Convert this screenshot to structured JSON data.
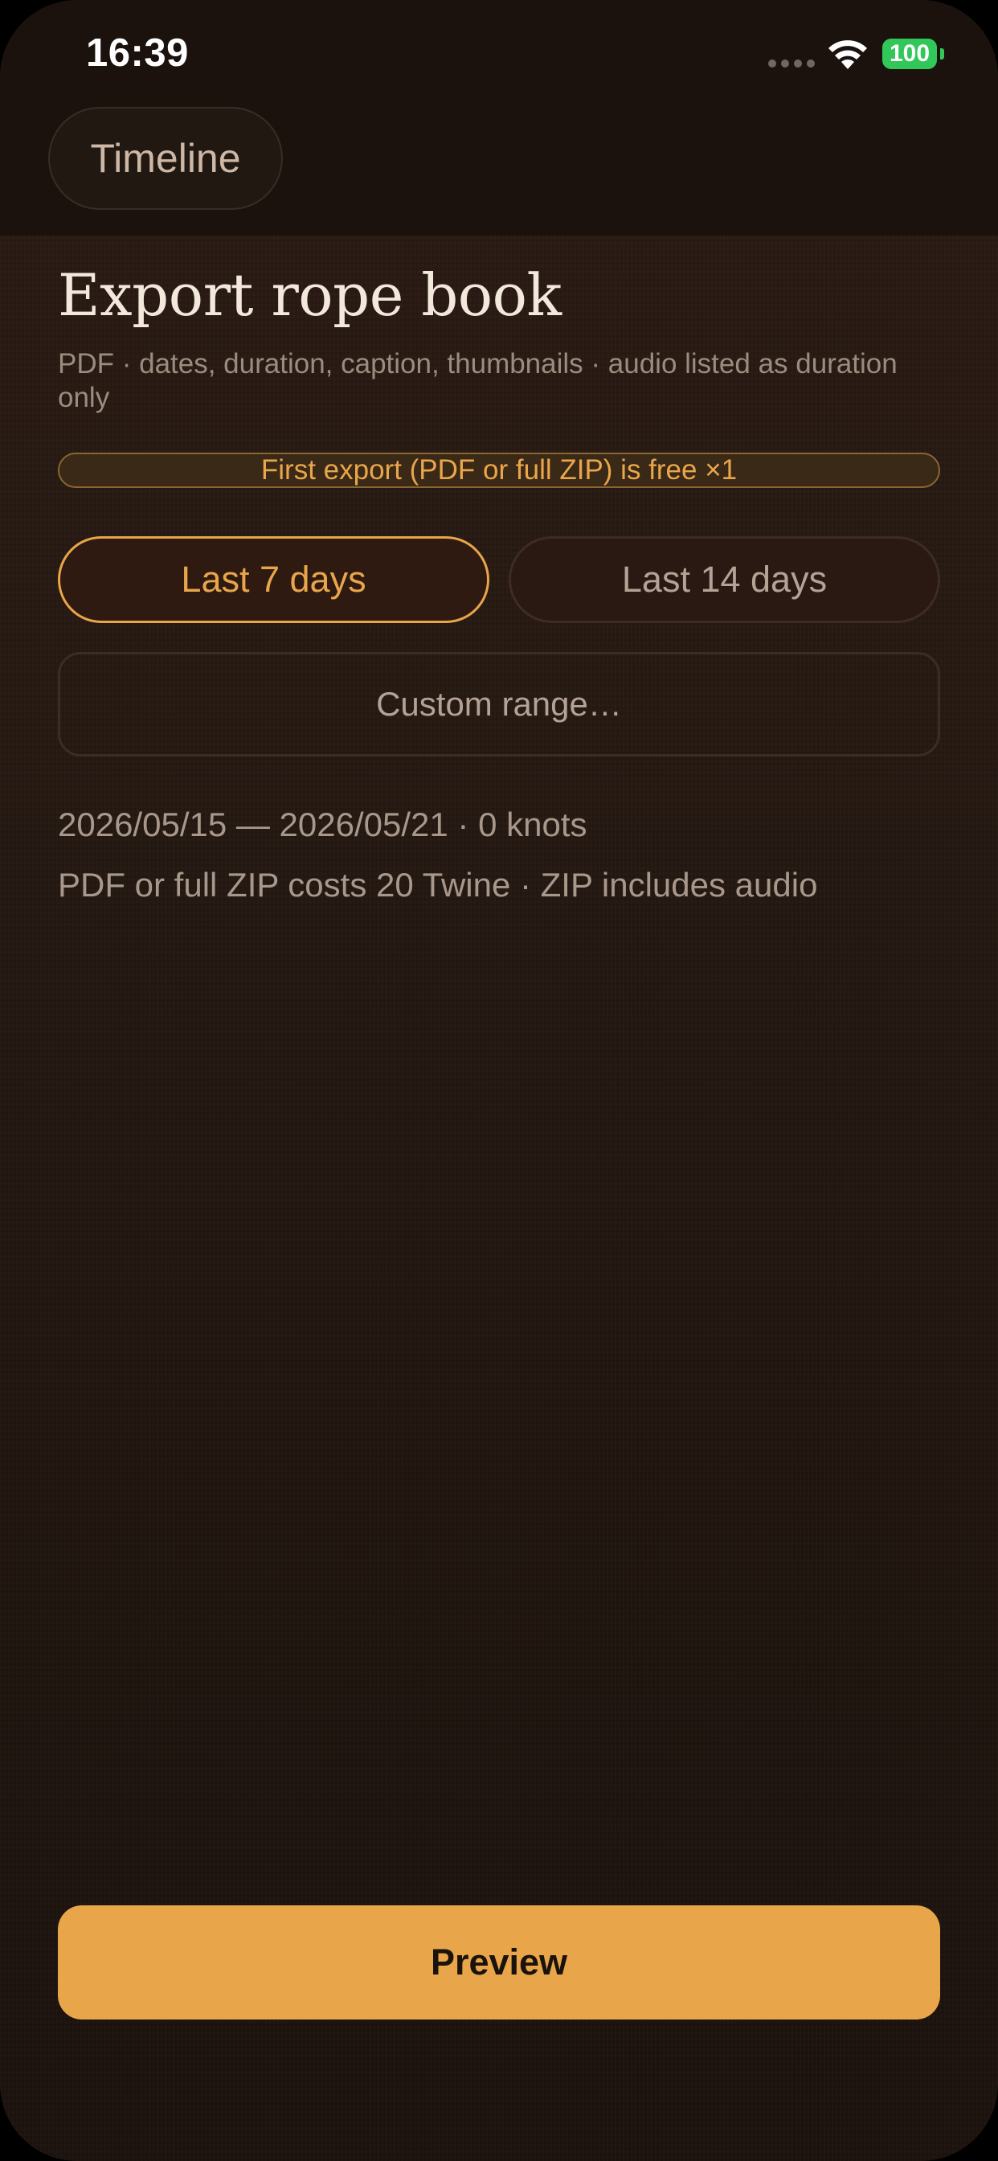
{
  "status_bar": {
    "time": "16:39",
    "battery": "100",
    "wifi_icon": "wifi-icon",
    "signal_icon": "cellular-signal-icon"
  },
  "nav": {
    "back_label": "Timeline"
  },
  "header": {
    "title": "Export rope book",
    "subtitle": "PDF · dates, duration, caption, thumbnails · audio listed as duration only"
  },
  "banner": {
    "text": "First export (PDF or full ZIP) is free ×1"
  },
  "range_options": [
    {
      "label": "Last 7 days",
      "selected": true
    },
    {
      "label": "Last 14 days",
      "selected": false
    }
  ],
  "custom_range_label": "Custom range…",
  "summary": {
    "range_text": "2026/05/15 — 2026/05/21 · 0 knots",
    "cost_text": "PDF or full ZIP costs 20 Twine · ZIP includes audio"
  },
  "actions": {
    "preview_label": "Preview"
  },
  "colors": {
    "accent": "#e8a54a",
    "background": "#241811",
    "nav_background": "#1b120e",
    "text_primary": "#f3e8dc",
    "text_secondary": "#a8988b",
    "battery_green": "#32c759"
  }
}
